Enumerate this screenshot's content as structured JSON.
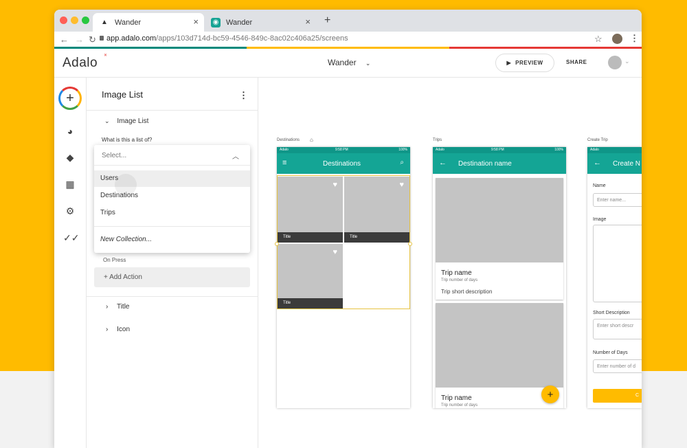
{
  "browser": {
    "tabs": [
      {
        "title": "Wander",
        "close": "×"
      },
      {
        "title": "Wander",
        "close": "×"
      }
    ],
    "new_tab": "+",
    "url_host": "app.adalo.com",
    "url_path": "/apps/103d714d-bc59-4546-849c-8ac02c406a25/screens",
    "colors": {
      "red": "#e53935",
      "orange": "#ff9800",
      "green": "#00897b",
      "yellow": "#ffbb00"
    }
  },
  "header": {
    "logo": "Adalo",
    "project": "Wander",
    "preview": "PREVIEW",
    "share": "SHARE"
  },
  "rail": {
    "add": "+",
    "icons": [
      "palette-icon",
      "layers-icon",
      "database-icon",
      "gear-icon",
      "checks-icon"
    ]
  },
  "panel": {
    "title": "Image List",
    "section": "Image List",
    "question": "What is this a list of?",
    "select_placeholder": "Select...",
    "options": [
      "Users",
      "Destinations",
      "Trips"
    ],
    "new_collection": "New Collection...",
    "on_press": "On Press",
    "add_action": "+ Add Action",
    "groups": [
      "Title",
      "Icon"
    ]
  },
  "screens": {
    "destinations": {
      "label": "Destinations",
      "carrier": "Adalo",
      "time": "9:58 PM",
      "battery": "100%",
      "title": "Destinations",
      "tile_caption": "Title"
    },
    "trips": {
      "label": "Trips",
      "carrier": "Adalo",
      "time": "9:58 PM",
      "battery": "100%",
      "title": "Destination name",
      "card1_title": "Trip name",
      "card1_sub": "Trip number of days",
      "card1_desc": "Trip short description",
      "card2_title": "Trip name",
      "card2_sub": "Trip number of days",
      "fab": "+"
    },
    "create_trip": {
      "label": "Create Trip",
      "carrier": "Adalo",
      "title": "Create N",
      "name_label": "Name",
      "name_placeholder": "Enter name...",
      "image_label": "Image",
      "short_desc_label": "Short Description",
      "short_desc_placeholder": "Enter short descr",
      "days_label": "Number of Days",
      "days_placeholder": "Enter number of d",
      "button_text": "C"
    }
  }
}
